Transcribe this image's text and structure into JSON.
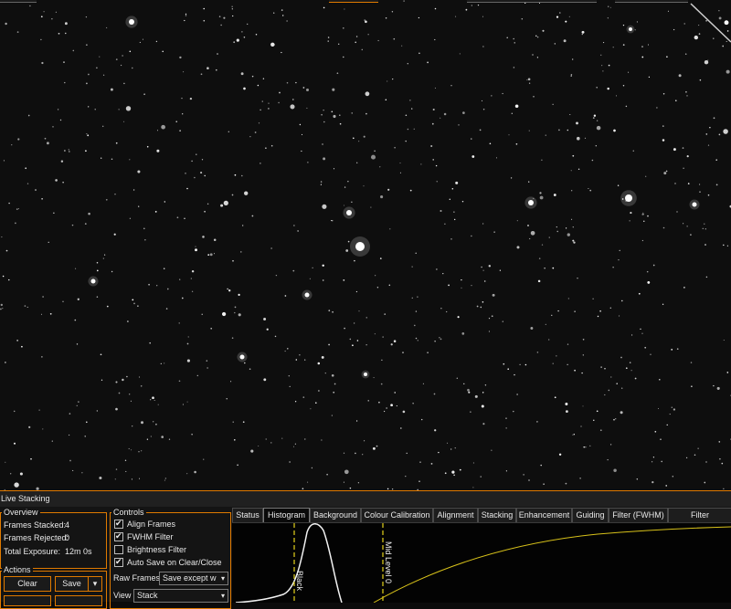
{
  "panel": {
    "title": "Live Stacking"
  },
  "overview": {
    "label": "Overview",
    "frames_stacked_label": "Frames Stacked:",
    "frames_stacked_value": "4",
    "frames_rejected_label": "Frames Rejected:",
    "frames_rejected_value": "0",
    "total_exposure_label": "Total Exposure:",
    "total_exposure_value": "12m 0s"
  },
  "actions": {
    "label": "Actions",
    "clear_label": "Clear",
    "save_label": "Save"
  },
  "controls": {
    "label": "Controls",
    "align_frames": {
      "label": "Align Frames",
      "checked": true
    },
    "fwhm_filter": {
      "label": "FWHM Filter",
      "checked": true
    },
    "brightness_filter": {
      "label": "Brightness Filter",
      "checked": false
    },
    "auto_save": {
      "label": "Auto Save on Clear/Close",
      "checked": true
    },
    "raw_frames_label": "Raw Frames",
    "raw_frames_value": "Save except w",
    "view_label": "View",
    "view_value": "Stack"
  },
  "tabs": [
    "Status",
    "Histogram",
    "Background",
    "Colour Calibration",
    "Alignment",
    "Stacking",
    "Enhancement",
    "Guiding",
    "Filter (FWHM)",
    "Filter (Brightness)"
  ],
  "active_tab": "Histogram",
  "histogram": {
    "black_label": "Black",
    "mid_label": "Mid Level",
    "mid_value": "0"
  },
  "colors": {
    "accent": "#e07a00",
    "curve": "#d8c21a",
    "background": "#0e0e0e"
  }
}
